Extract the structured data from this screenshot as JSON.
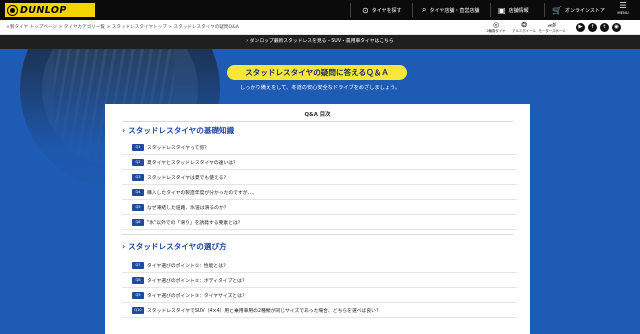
{
  "header": {
    "logo": "DUNLOP",
    "nav": [
      {
        "icon": "tire-search-icon",
        "label": "タイヤを探す"
      },
      {
        "icon": "store-search-icon",
        "label": "タイヤ店舗・直営店舗"
      },
      {
        "icon": "shop-icon",
        "label": "店舗情報"
      },
      {
        "icon": "cart-icon",
        "label": "オンラインストア"
      }
    ],
    "menu_label": "MENU"
  },
  "breadcrumb": "×製タイヤ トップページ > タイヤカテゴリー覧 > スタッドレスタイヤトップ > スタッドレスタイヤの疑問Q&A",
  "sub_icons": [
    {
      "label": "2輪用タイヤ"
    },
    {
      "label": "アルミホイール"
    },
    {
      "label": "モータースポーツ"
    }
  ],
  "sns": [
    "youtube",
    "facebook",
    "twitter",
    "instagram"
  ],
  "notice_bar": "ダンロップ最新スタッドレスを見る・SUV・農用車タイヤはこちら",
  "hero": {
    "title": "スタッドレスタイヤの疑問に答えるＱ＆Ａ",
    "subtitle": "しっかり備えをして、冬道の安心安全なドライブをめざしましょう。"
  },
  "qa": {
    "toc_title": "Q&A 目次",
    "sections": [
      {
        "heading": "スタッドレスタイヤの基礎知識",
        "items": [
          {
            "badge": "Q1",
            "text": "スタッドレスタイヤって何？"
          },
          {
            "badge": "Q2",
            "text": "夏タイヤとスタッドレスタイヤの違いは？"
          },
          {
            "badge": "Q3",
            "text": "スタッドレスタイヤは夏でも使える？"
          },
          {
            "badge": "Q4",
            "text": "購入したタイヤの製造年度が分かったのですが、、、"
          },
          {
            "badge": "Q5",
            "text": "なぜ凍結した道路、氷道は滑るのか？"
          },
          {
            "badge": "Q6",
            "text": "\"氷\"以外での「滑り」を誘発する要素とは？"
          }
        ]
      },
      {
        "heading": "スタッドレスタイヤの選び方",
        "items": [
          {
            "badge": "Q7",
            "text": "タイヤ選びのポイント①：性能とは？"
          },
          {
            "badge": "Q8",
            "text": "タイヤ選びのポイント②：ボディタイプとは？"
          },
          {
            "badge": "Q9",
            "text": "タイヤ選びのポイント③：タイヤサイズとは？"
          },
          {
            "badge": "Q10",
            "text": "スタッドレスタイヤでSUV（4×4）用と乗用車用の2種類が同じサイズであった場合、どちらを選べば良い？"
          }
        ]
      }
    ]
  }
}
